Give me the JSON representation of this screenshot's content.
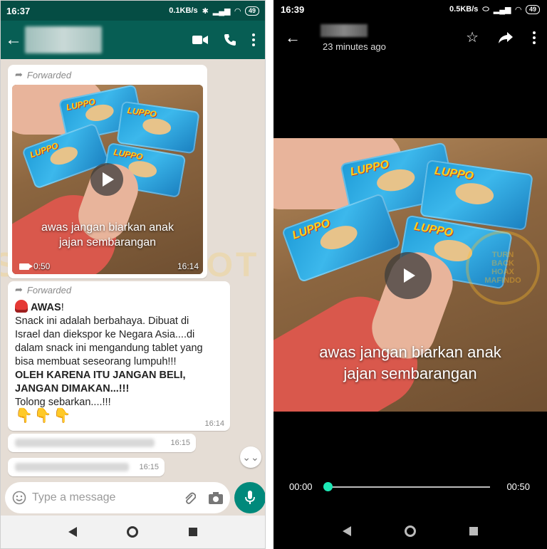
{
  "left": {
    "status": {
      "time": "16:37",
      "speed": "0.1KB/s",
      "battery": "49"
    },
    "header": {},
    "messages": [
      {
        "forwarded_label": "Forwarded",
        "video_caption_line1": "awas jangan biarkan anak",
        "video_caption_line2": "jajan sembarangan",
        "duration": "0:50",
        "time": "16:14"
      },
      {
        "forwarded_label": "Forwarded",
        "title": "AWAS",
        "title_suffix": "!",
        "body_line1": "Snack ini adalah berbahaya. Dibuat di",
        "body_line2": "Israel dan diekspor ke Negara Asia....di",
        "body_line3": "dalam snack ini mengandung tablet yang",
        "body_line4": "bisa membuat seseorang lumpuh!!!",
        "bold_line1": "OLEH KARENA ITU JANGAN BELI,",
        "bold_line2": "JANGAN DIMAKAN...!!!",
        "tail": "Tolong sebarkan....!!!",
        "emoji": "👇👇👇",
        "time": "16:14"
      },
      {
        "time": "16:15"
      },
      {
        "time": "16:15"
      }
    ],
    "input": {
      "placeholder": "Type a message"
    },
    "snack_brand": "LUPPO",
    "watermark": "SCREENSHOT"
  },
  "right": {
    "status": {
      "time": "16:39",
      "speed": "0.5KB/s",
      "battery": "49"
    },
    "header": {
      "subtitle": "23 minutes ago"
    },
    "video_caption_line1": "awas jangan biarkan anak",
    "video_caption_line2": "jajan sembarangan",
    "progress": {
      "current": "00:00",
      "total": "00:50",
      "fraction": 0.0
    },
    "seal_lines": [
      "TURN",
      "BACK",
      "HOAX",
      "MAFINDO"
    ]
  },
  "colors": {
    "wa_dark": "#054d44",
    "wa_primary": "#075e54",
    "accent": "#00897b",
    "progress_knob": "#1de9b6"
  }
}
